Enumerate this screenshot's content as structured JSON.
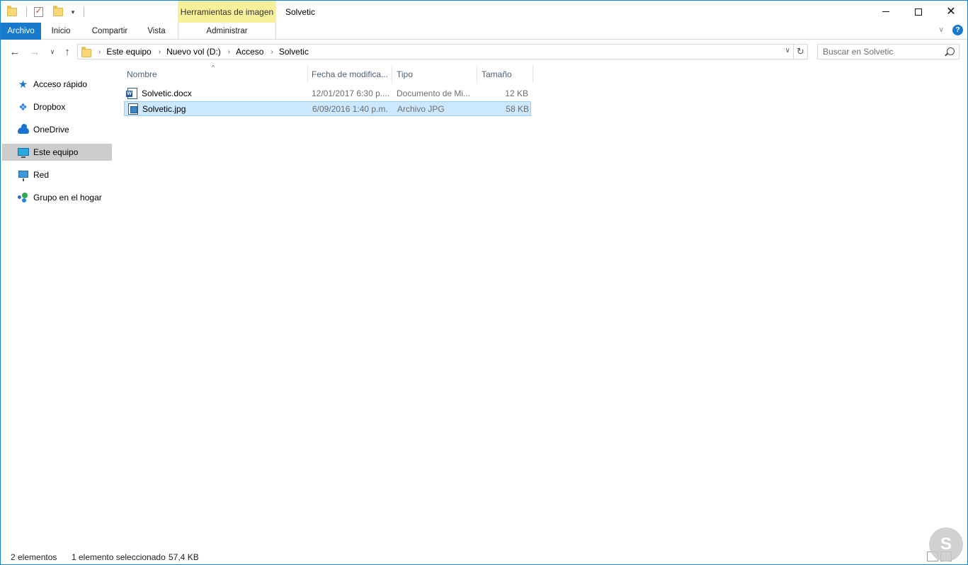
{
  "window": {
    "title": "Solvetic"
  },
  "ribbon": {
    "context_tab_top": "Herramientas de imagen",
    "tabs": {
      "file": "Archivo",
      "home": "Inicio",
      "share": "Compartir",
      "view": "Vista"
    },
    "context_tab": "Administrar",
    "help": "?"
  },
  "address": {
    "breadcrumbs": [
      "Este equipo",
      "Nuevo vol (D:)",
      "Acceso",
      "Solvetic"
    ]
  },
  "search": {
    "placeholder": "Buscar en Solvetic"
  },
  "nav_pane": {
    "items": [
      {
        "label": "Acceso rápido",
        "icon": "star-icon"
      },
      {
        "label": "Dropbox",
        "icon": "dropbox-icon"
      },
      {
        "label": "OneDrive",
        "icon": "cloud-icon"
      },
      {
        "label": "Este equipo",
        "icon": "computer-icon",
        "selected": true
      },
      {
        "label": "Red",
        "icon": "network-icon"
      },
      {
        "label": "Grupo en el hogar",
        "icon": "homegroup-icon"
      }
    ]
  },
  "file_list": {
    "columns": {
      "name": "Nombre",
      "date": "Fecha de modifica...",
      "type": "Tipo",
      "size": "Tamaño"
    },
    "rows": [
      {
        "name": "Solvetic.docx",
        "date": "12/01/2017 6:30 p....",
        "type": "Documento de Mi...",
        "size": "12 KB",
        "icon": "word-document-icon",
        "selected": false
      },
      {
        "name": "Solvetic.jpg",
        "date": "6/09/2016 1:40 p.m.",
        "type": "Archivo JPG",
        "size": "58 KB",
        "icon": "image-file-icon",
        "selected": true
      }
    ]
  },
  "status": {
    "count": "2 elementos",
    "selection": "1 elemento seleccionado",
    "size": "57,4 KB"
  },
  "colors": {
    "accent": "#1979ca",
    "context_tab": "#f6f09a",
    "selection_bg": "#cce8ff",
    "nav_selected": "#cccccc"
  }
}
